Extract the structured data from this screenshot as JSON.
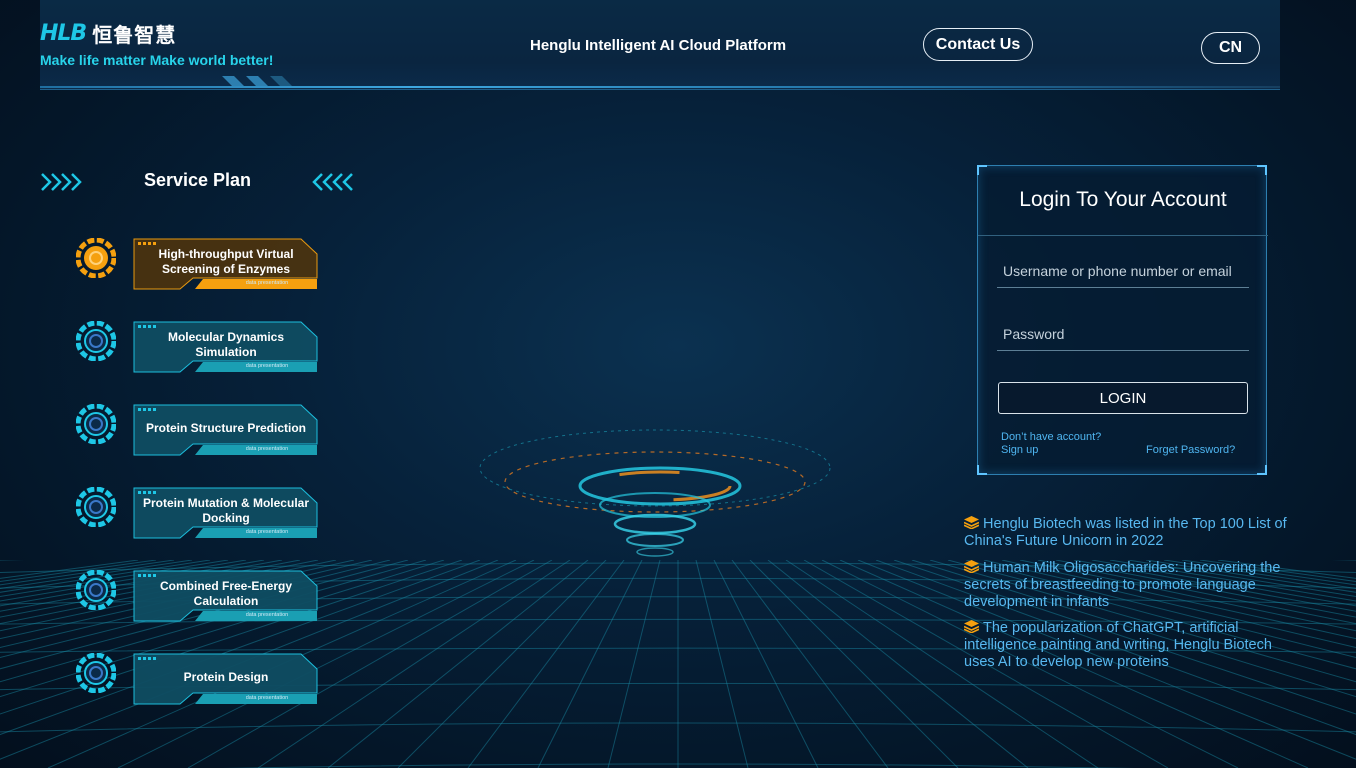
{
  "header": {
    "logo_text": "HLB",
    "logo_cn": "恒鲁智慧",
    "slogan": "Make life matter Make world better!",
    "platform_title": "Henglu Intelligent AI Cloud Platform",
    "contact_label": "Contact Us",
    "lang_label": "CN"
  },
  "service_plan": {
    "title": "Service Plan",
    "items": [
      {
        "label": "High-throughput Virtual Screening of Enzymes",
        "sub": "data presentation",
        "active": true
      },
      {
        "label": "Molecular Dynamics Simulation",
        "sub": "data presentation",
        "active": false
      },
      {
        "label": "Protein Structure Prediction",
        "sub": "data presentation",
        "active": false
      },
      {
        "label": "Protein Mutation & Molecular Docking",
        "sub": "data presentation",
        "active": false
      },
      {
        "label": "Combined Free-Energy Calculation",
        "sub": "data presentation",
        "active": false
      },
      {
        "label": "Protein Design",
        "sub": "data presentation",
        "active": false
      }
    ]
  },
  "login": {
    "title": "Login To Your Account",
    "username_placeholder": "Username or phone number or email",
    "username_value": "",
    "password_placeholder": "Password",
    "password_value": "",
    "login_label": "LOGIN",
    "no_account_label": "Don’t have account?",
    "signup_label": "Sign up",
    "forget_label": "Forget Password?"
  },
  "news": [
    {
      "text": "Henglu Biotech was listed in the Top 100 List of China's Future Unicorn in 2022"
    },
    {
      "text": "Human Milk Oligosaccharides: Uncovering the secrets of breastfeeding to promote language development in infants"
    },
    {
      "text": "The popularization of ChatGPT, artificial intelligence painting and writing, Henglu Biotech uses AI to develop new proteins"
    }
  ],
  "colors": {
    "accent_cyan": "#1ec7e6",
    "active_orange": "#f5a00f",
    "link_blue": "#58b8f0",
    "card_teal": "#0f4d62"
  },
  "icons": {
    "news_bullet": "layers-icon",
    "service_icon": "gear-ring-icon"
  }
}
